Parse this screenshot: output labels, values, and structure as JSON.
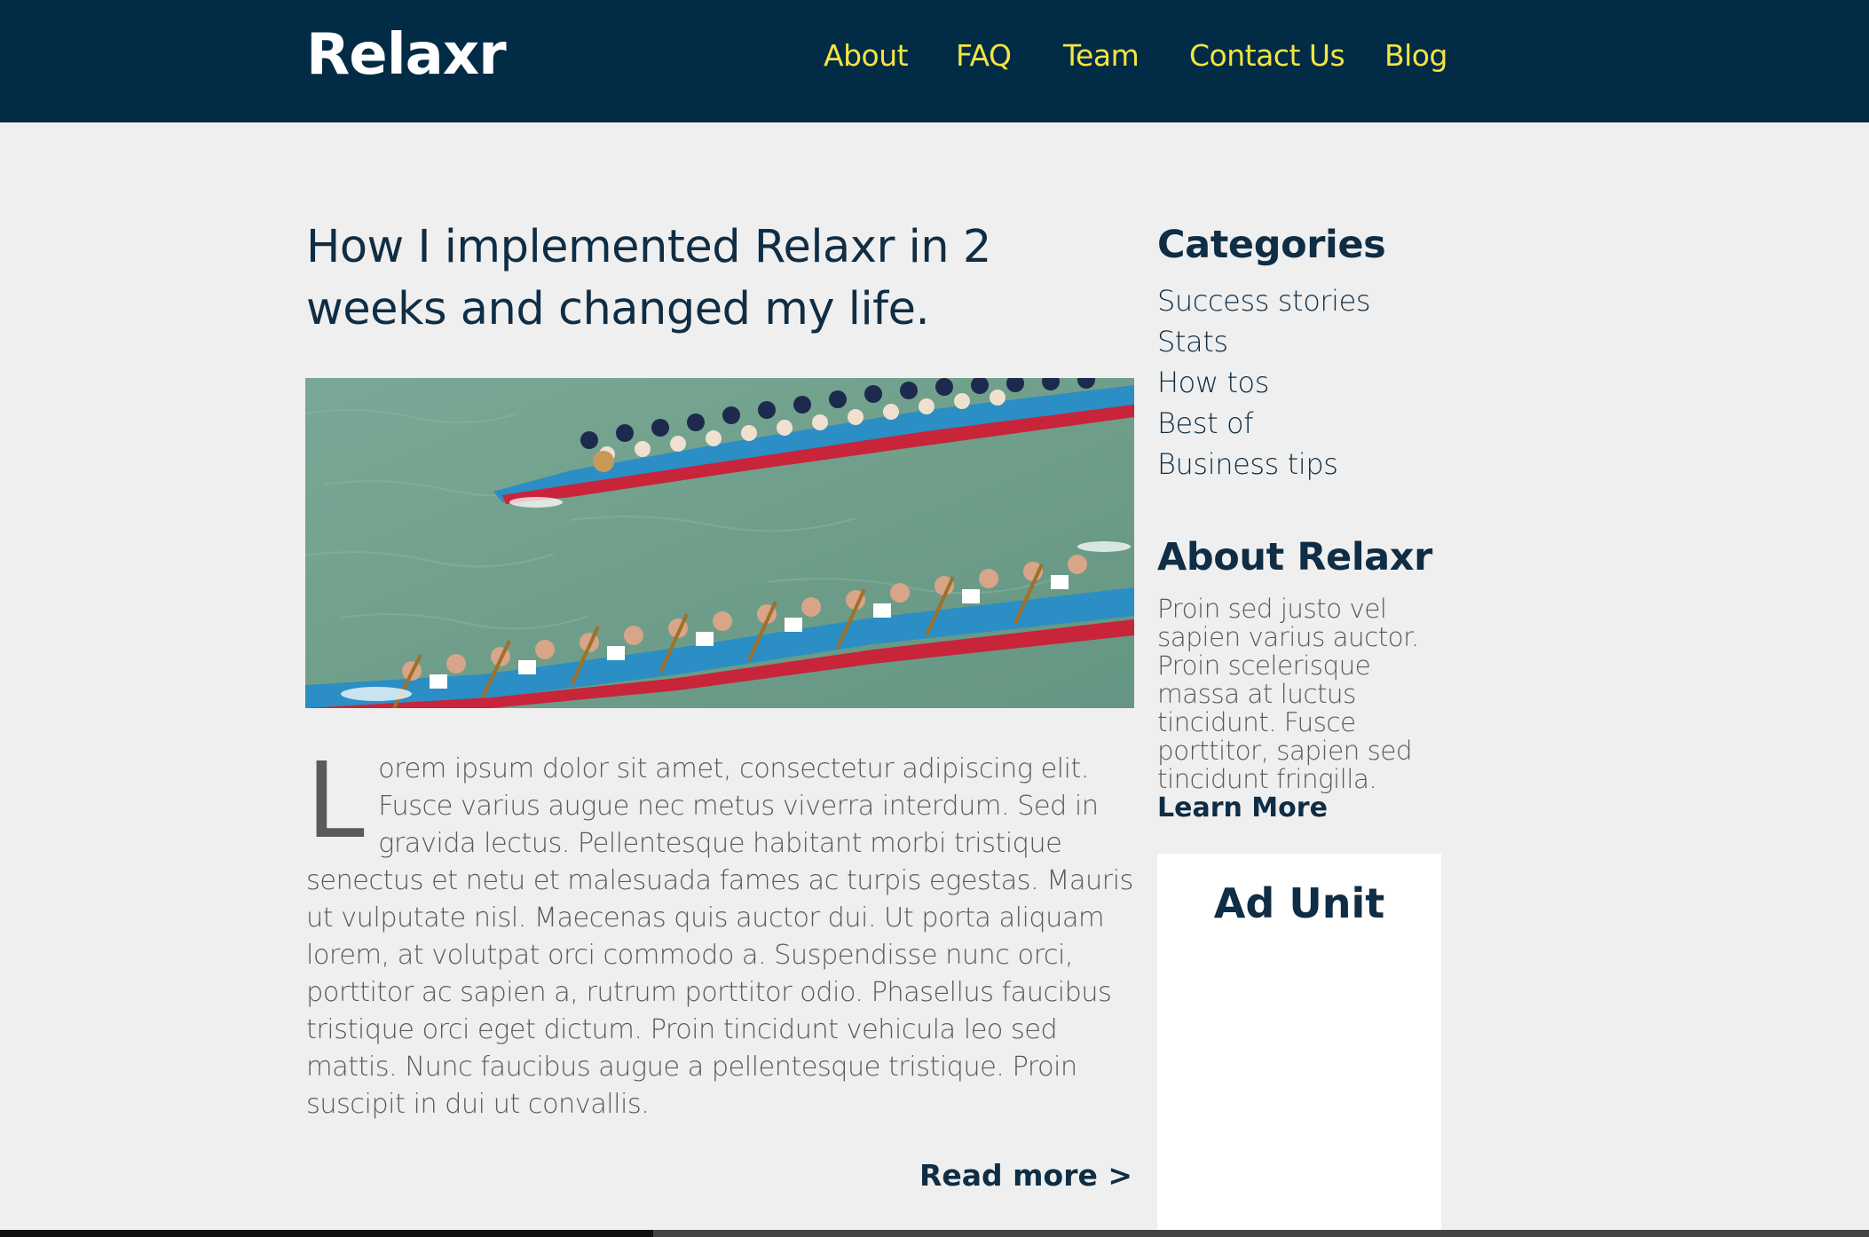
{
  "header": {
    "logo": "Relaxr",
    "nav": [
      {
        "label": "About"
      },
      {
        "label": "FAQ"
      },
      {
        "label": "Team"
      },
      {
        "label": "Contact Us"
      },
      {
        "label": "Blog"
      }
    ]
  },
  "article": {
    "title": "How I implemented Relaxr in 2 weeks and changed my life.",
    "hero_alt": "Dragon boat racing photo",
    "drop_cap": "L",
    "body": "orem ipsum dolor sit amet, consectetur adipiscing elit. Fusce varius augue nec metus viverra interdum. Sed in gravida lectus. Pellentesque habitant morbi tristique senectus et netu et malesuada fames ac turpis egestas. Mauris ut vulputate nisl. Maecenas quis auctor dui. Ut porta aliquam lorem, at volutpat orci commodo a. Suspendisse nunc orci, porttitor ac sapien a, rutrum porttitor odio. Phasellus faucibus tristique orci eget dictum. Proin tincidunt vehicula leo sed mattis. Nunc faucibus augue a pellentesque tristique. Proin suscipit in dui ut convallis.",
    "read_more": "Read more >"
  },
  "sidebar": {
    "categories_heading": "Categories",
    "categories": [
      {
        "label": "Success stories"
      },
      {
        "label": "Stats"
      },
      {
        "label": "How tos"
      },
      {
        "label": "Best of"
      },
      {
        "label": "Business tips"
      }
    ],
    "about_heading": "About Relaxr",
    "about_text": "Proin sed justo vel sapien varius auctor. Proin scelerisque massa at luctus tincidunt. Fusce porttitor, sapien sed tincidunt fringilla.",
    "learn_more": "Learn More",
    "ad_label": "Ad Unit"
  },
  "colors": {
    "header_bg": "#022b46",
    "nav_link": "#f2e541",
    "page_bg": "#efefef",
    "heading": "#0f2d44",
    "body_text": "#5a5a5a"
  }
}
